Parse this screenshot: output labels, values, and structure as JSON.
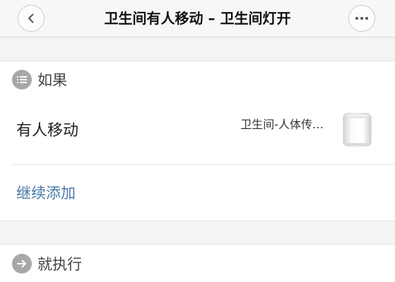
{
  "navbar": {
    "title": "卫生间有人移动 – 卫生间灯开",
    "back_icon": "chevron-left-icon",
    "more_icon": "more-dots-icon"
  },
  "if_section": {
    "label": "如果",
    "icon": "list-icon"
  },
  "condition": {
    "label": "有人移动",
    "device": "卫生间-人体传…",
    "device_icon": "motion-sensor-icon"
  },
  "add_more_label": "继续添加",
  "then_section": {
    "label": "就执行",
    "icon": "arrow-right-icon"
  },
  "colors": {
    "link": "#4a78a8",
    "section_icon_bg": "#a8a8a8",
    "page_bg": "#f4f4f4"
  }
}
